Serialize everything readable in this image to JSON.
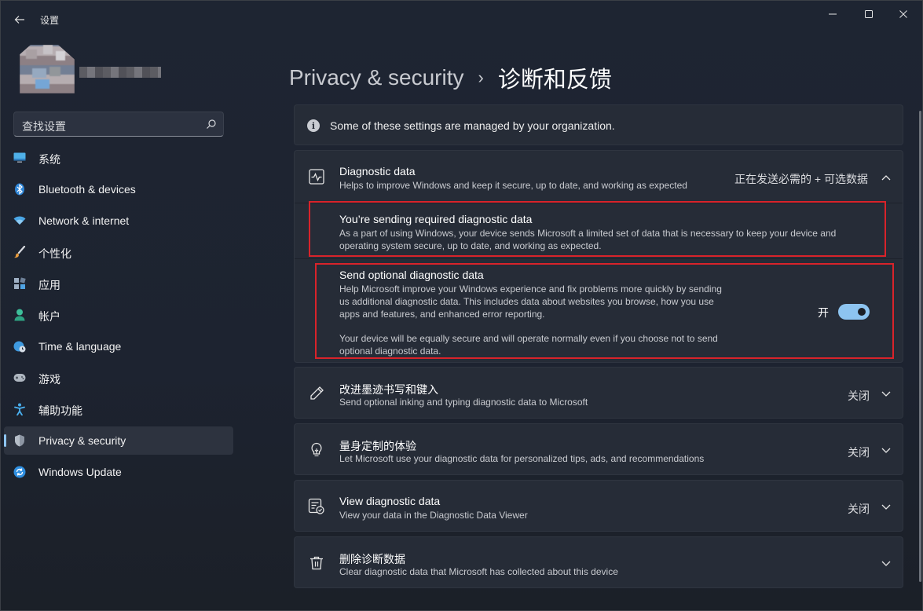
{
  "window": {
    "app_title": "设置",
    "controls": [
      "minimize",
      "maximize",
      "close"
    ]
  },
  "sidebar": {
    "search_placeholder": "查找设置",
    "items": [
      {
        "label": "系统",
        "icon": "monitor-icon",
        "active": false
      },
      {
        "label": "Bluetooth & devices",
        "icon": "bluetooth-icon",
        "active": false
      },
      {
        "label": "Network & internet",
        "icon": "wifi-icon",
        "active": false
      },
      {
        "label": "个性化",
        "icon": "brush-icon",
        "active": false
      },
      {
        "label": "应用",
        "icon": "apps-icon",
        "active": false
      },
      {
        "label": "帐户",
        "icon": "person-icon",
        "active": false
      },
      {
        "label": "Time & language",
        "icon": "globe-clock-icon",
        "active": false
      },
      {
        "label": "游戏",
        "icon": "gamepad-icon",
        "active": false
      },
      {
        "label": "辅助功能",
        "icon": "accessibility-icon",
        "active": false
      },
      {
        "label": "Privacy & security",
        "icon": "shield-icon",
        "active": true
      },
      {
        "label": "Windows Update",
        "icon": "update-icon",
        "active": false
      }
    ]
  },
  "header": {
    "parent": "Privacy & security",
    "separator": "›",
    "current": "诊断和反馈"
  },
  "notice": {
    "text": "Some of these settings are managed by your organization."
  },
  "diagnostic": {
    "title": "Diagnostic data",
    "desc": "Helps to improve Windows and keep it secure, up to date, and working as expected",
    "status": "正在发送必需的 + 可选数据",
    "required": {
      "title": "You’re sending required diagnostic data",
      "desc": "As a part of using Windows, your device sends Microsoft a limited set of data that is necessary to keep your device and operating system secure, up to date, and working as expected."
    },
    "optional": {
      "title": "Send optional diagnostic data",
      "desc1": "Help Microsoft improve your Windows experience and fix problems more quickly by sending us additional diagnostic data. This includes data about websites you browse, how you use apps and features, and enhanced error reporting.",
      "desc2": "Your device will be equally secure and will operate normally even if you choose not to send optional diagnostic data.",
      "toggle_label": "开",
      "toggle_on": true
    }
  },
  "rows": [
    {
      "title": "改进墨迹书写和键入",
      "desc": "Send optional inking and typing diagnostic data to Microsoft",
      "status": "关闭",
      "icon": "pen-icon"
    },
    {
      "title": "量身定制的体验",
      "desc": "Let Microsoft use your diagnostic data for personalized tips, ads, and recommendations",
      "status": "关闭",
      "icon": "lightbulb-icon"
    },
    {
      "title": "View diagnostic data",
      "desc": "View your data in the Diagnostic Data Viewer",
      "status": "关闭",
      "icon": "data-viewer-icon"
    },
    {
      "title": "删除诊断数据",
      "desc": "Clear diagnostic data that Microsoft has collected about this device",
      "status": "",
      "icon": "trash-icon"
    }
  ],
  "colors": {
    "accent": "#8dc4f0",
    "highlight_border": "#d8232a",
    "card_bg": "#262c37"
  }
}
